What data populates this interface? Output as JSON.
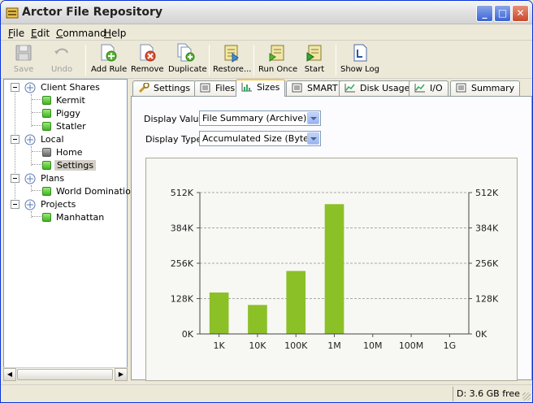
{
  "window": {
    "title": "Arctor File Repository"
  },
  "menu": [
    {
      "key": "F",
      "rest": "ile"
    },
    {
      "key": "E",
      "rest": "dit"
    },
    {
      "key": "C",
      "rest": "ommand"
    },
    {
      "key": "H",
      "rest": "elp"
    }
  ],
  "toolbar": {
    "save": "Save",
    "undo": "Undo",
    "add_rule": "Add Rule",
    "remove": "Remove",
    "duplicate": "Duplicate",
    "restore": "Restore...",
    "run_once": "Run Once",
    "start": "Start",
    "show_log": "Show Log"
  },
  "tree": {
    "groups": [
      {
        "label": "Client Shares",
        "children": [
          "Kermit",
          "Piggy",
          "Statler"
        ]
      },
      {
        "label": "Local",
        "children": [
          "Home",
          "Settings"
        ]
      },
      {
        "label": "Plans",
        "children": [
          "World Domination"
        ]
      },
      {
        "label": "Projects",
        "children": [
          "Manhattan"
        ]
      }
    ],
    "selected": "Settings"
  },
  "tabs": [
    "Settings",
    "Files",
    "Sizes",
    "SMART",
    "Disk Usage",
    "I/O",
    "Summary"
  ],
  "active_tab": "Sizes",
  "form": {
    "display_value_label": "Display Value",
    "display_value": "File Summary (Archive)",
    "display_type_label": "Display Type",
    "display_type": "Accumulated Size (Byte)"
  },
  "chart_data": {
    "type": "bar",
    "categories": [
      "1K",
      "10K",
      "100K",
      "1M",
      "10M",
      "100M",
      "1G"
    ],
    "values": [
      150,
      105,
      228,
      470,
      0,
      0,
      0
    ],
    "ylim": [
      0,
      512
    ],
    "y_ticks": [
      0,
      128,
      256,
      384,
      512
    ],
    "y_tick_labels": [
      "0K",
      "128K",
      "256K",
      "384K",
      "512K"
    ],
    "color": "#8cc027",
    "grid": true,
    "right_axis": true
  },
  "status": {
    "free": "D:  3.6 GB free"
  }
}
